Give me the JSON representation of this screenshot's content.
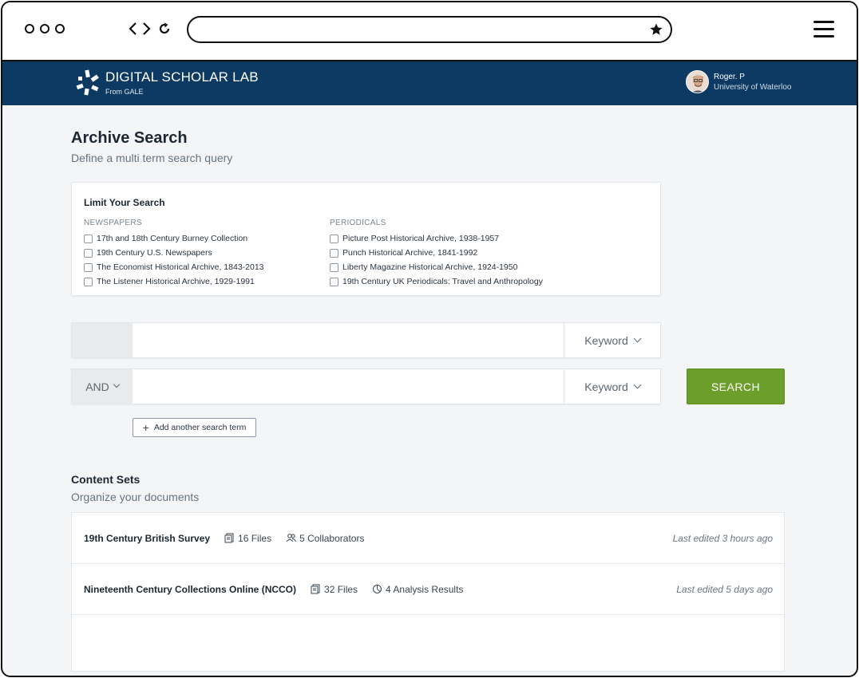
{
  "app": {
    "brand_name": "DIGITAL SCHOLAR LAB",
    "brand_sub": "From GALE",
    "user_name": "Roger. P",
    "user_org": "University of Waterloo"
  },
  "browser": {
    "url": ""
  },
  "page": {
    "title": "Archive Search",
    "subtitle": "Define a multi term search query"
  },
  "limit": {
    "title": "Limit Your Search",
    "newspapers_label": "NEWSPAPERS",
    "periodicals_label": "PERIODICALS",
    "newspapers": [
      "17th and 18th Century Burney Collection",
      "19th Century U.S. Newspapers",
      "The Economist Historical Archive, 1843-2013",
      "The Listener Historical Archive, 1929-1991"
    ],
    "periodicals": [
      "Picture Post Historical Archive, 1938-1957",
      "Punch Historical Archive, 1841-1992",
      "Liberty Magazine Historical Archive, 1924-1950",
      "19th Century UK Periodicals: Travel and Anthropology"
    ]
  },
  "search": {
    "row1_prefix": "",
    "row1_value": "",
    "row1_type": "Keyword",
    "row2_operator": "AND",
    "row2_value": "",
    "row2_type": "Keyword",
    "search_label": "SEARCH",
    "add_term_label": "Add another search term"
  },
  "content_sets": {
    "title": "Content Sets",
    "subtitle": "Organize your documents",
    "items": [
      {
        "name": "19th Century British Survey",
        "files": "16 Files",
        "extra": "5 Collaborators",
        "extra_icon": "collaborators-icon",
        "edited": "Last edited 3 hours ago"
      },
      {
        "name": "Nineteenth Century Collections Online (NCCO)",
        "files": "32 Files",
        "extra": "4 Analysis Results",
        "extra_icon": "analysis-icon",
        "edited": "Last edited 5 days ago"
      }
    ]
  },
  "colors": {
    "header_bg": "#0d3a63",
    "search_button": "#6c9e2b",
    "page_bg": "#f3f5f7"
  }
}
